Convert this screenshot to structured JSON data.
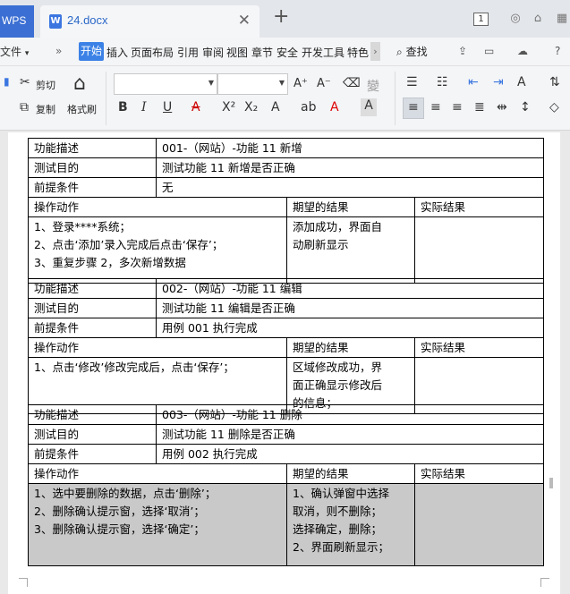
{
  "app": {
    "brand": "WPS",
    "document_name": "24.docx",
    "window_count": "1"
  },
  "menu": {
    "file": "文件",
    "tabs": [
      "开始",
      "插入",
      "页面布局",
      "引用",
      "审阅",
      "视图",
      "章节",
      "安全",
      "开发工具",
      "特色"
    ],
    "search": "查找"
  },
  "ribbon": {
    "cut": "剪切",
    "copy": "复制",
    "format_painter": "格式刷"
  },
  "cases": [
    {
      "label_desc": "功能描述",
      "desc": "001-（网站）-功能 11 新增",
      "label_purpose": "测试目的",
      "purpose": "测试功能 11 新增是否正确",
      "label_pre": "前提条件",
      "pre": "无",
      "h_action": "操作动作",
      "h_expected": "期望的结果",
      "h_actual": "实际结果",
      "steps": [
        "1、登录****系统；",
        "2、点击‘添加’录入完成后点击‘保存’；",
        "3、重复步骤 2，多次新增数据"
      ],
      "expected": [
        "添加成功，界面自",
        "动刷新显示"
      ]
    },
    {
      "label_desc": "功能描述",
      "desc": "002-（网站）-功能 11 编辑",
      "label_purpose": "测试目的",
      "purpose": "测试功能 11 编辑是否正确",
      "label_pre": "前提条件",
      "pre": "用例 001 执行完成",
      "h_action": "操作动作",
      "h_expected": "期望的结果",
      "h_actual": "实际结果",
      "steps": [
        "1、点击‘修改’修改完成后，点击‘保存’；"
      ],
      "expected": [
        "区域修改成功，界",
        "面正确显示修改后",
        "的信息；"
      ]
    },
    {
      "label_desc": "功能描述",
      "desc": "003-（网站）-功能 11 删除",
      "label_purpose": "测试目的",
      "purpose": "测试功能 11 删除是否正确",
      "label_pre": "前提条件",
      "pre": "用例 002 执行完成",
      "h_action": "操作动作",
      "h_expected": "期望的结果",
      "h_actual": "实际结果",
      "steps": [
        "1、选中要删除的数据，点击‘删除’；",
        "2、删除确认提示窗，选择‘取消’；",
        "3、删除确认提示窗，选择‘确定’；"
      ],
      "expected": [
        "1、确认弹窗中选择",
        "取消，则不删除；",
        "选择确定，删除；",
        "2、界面刷新显示；"
      ]
    }
  ],
  "colors": {
    "brand_tab": "#3b6fd3",
    "active_menu_tab": "#3c82e6",
    "selected_cell_shading": "#c9c9c9",
    "document_tab_text": "#2a68c8"
  }
}
